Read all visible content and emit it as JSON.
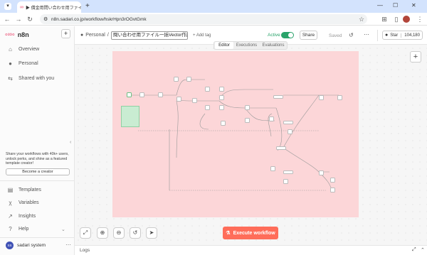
{
  "browser": {
    "tab_title": "▶ 償金用問い合わせ用ファイル…",
    "new_tab": "+",
    "url": "n8n.sadari.co.jp/workflow/hskrHpn3rOGvtGmk"
  },
  "sidebar": {
    "logo_text": "n8n",
    "add_button": "+",
    "items": [
      {
        "label": "Overview",
        "icon": "home-icon"
      },
      {
        "label": "Personal",
        "icon": "user-icon"
      },
      {
        "label": "Shared with you",
        "icon": "share-icon"
      }
    ],
    "promo": {
      "text": "Share your workflows with 40k+ users, unlock perks, and shine as a featured template creator!",
      "button": "Become a creator"
    },
    "bottom_items": [
      {
        "label": "Templates",
        "icon": "templates-icon"
      },
      {
        "label": "Variables",
        "icon": "variables-icon"
      },
      {
        "label": "Insights",
        "icon": "insights-icon"
      },
      {
        "label": "Help",
        "icon": "help-icon"
      }
    ],
    "user": {
      "initials": "SS",
      "name": "sadari system"
    }
  },
  "header": {
    "breadcrumb_project": "Personal",
    "breadcrumb_sep": "/",
    "workflow_name": "問い合わせ用ファイル一括Vector作成",
    "add_tag": "+ Add tag",
    "active_label": "Active",
    "share": "Share",
    "saved": "Saved",
    "star": "Star",
    "star_count": "104,180"
  },
  "tabs": [
    {
      "label": "Editor",
      "selected": true
    },
    {
      "label": "Executions",
      "selected": false
    },
    {
      "label": "Evaluations",
      "selected": false
    }
  ],
  "canvas": {
    "execute_button": "Execute workflow"
  },
  "logs": {
    "label": "Logs"
  },
  "colors": {
    "accent": "#ff6d5a",
    "active_toggle": "#29a36a",
    "frame": "#fcd6d8",
    "tabbar": "#d3e3fd"
  }
}
